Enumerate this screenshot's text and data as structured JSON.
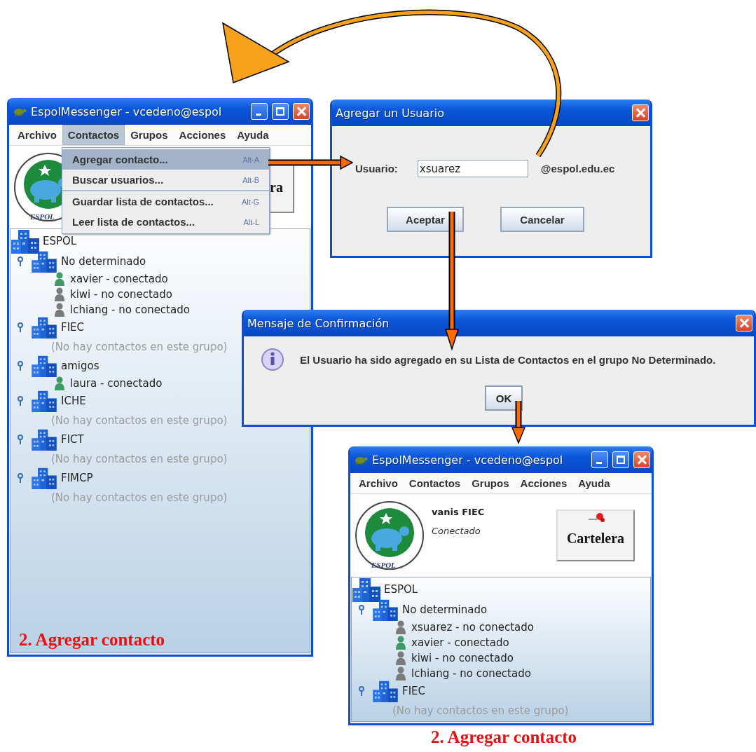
{
  "windows": [
    {
      "kind": "messenger",
      "title": "EspolMessenger - vcedeno@espol",
      "menus": [
        {
          "label": "Archivo",
          "selected": false
        },
        {
          "label": "Contactos",
          "selected": true
        },
        {
          "label": "Grupos",
          "selected": false
        },
        {
          "label": "Acciones",
          "selected": false
        },
        {
          "label": "Ayuda",
          "selected": false
        }
      ],
      "logo_text": "ESPOL",
      "board_button": {
        "label": "ra",
        "pinned": false
      },
      "dropdown": [
        {
          "label": "Agregar contacto...",
          "shortcut": "Alt-A",
          "selected": true,
          "separator_before": false
        },
        {
          "label": "Buscar usuarios...",
          "shortcut": "Alt-B",
          "selected": false,
          "separator_before": false
        },
        {
          "label": "Guardar lista de contactos...",
          "shortcut": "Alt-G",
          "selected": false,
          "separator_before": true
        },
        {
          "label": "Leer lista de contactos...",
          "shortcut": "Alt-L",
          "selected": false,
          "separator_before": false
        }
      ],
      "tree": {
        "label": "ESPOL",
        "kind": "root",
        "children": [
          {
            "label": "No determinado",
            "kind": "group",
            "children": [
              {
                "label": "xavier - conectado",
                "kind": "contact",
                "online": true
              },
              {
                "label": "kiwi - no conectado",
                "kind": "contact",
                "online": false
              },
              {
                "label": "lchiang - no conectado",
                "kind": "contact",
                "online": false
              }
            ]
          },
          {
            "label": "FIEC",
            "kind": "group",
            "children": [
              {
                "label": "(No hay contactos en este grupo)",
                "kind": "note"
              }
            ]
          },
          {
            "label": "amigos",
            "kind": "group",
            "children": [
              {
                "label": "laura - conectado",
                "kind": "contact",
                "online": true
              }
            ]
          },
          {
            "label": "ICHE",
            "kind": "group",
            "children": [
              {
                "label": "(No hay contactos en este grupo)",
                "kind": "note"
              }
            ]
          },
          {
            "label": "FICT",
            "kind": "group",
            "children": [
              {
                "label": "(No hay contactos en este grupo)",
                "kind": "note"
              }
            ]
          },
          {
            "label": "FIMCP",
            "kind": "group",
            "children": [
              {
                "label": "(No hay contactos en este grupo)",
                "kind": "note"
              }
            ]
          }
        ]
      },
      "caption": "2. Agregar contacto"
    },
    {
      "kind": "messenger",
      "title": "EspolMessenger - vcedeno@espol",
      "menus": [
        {
          "label": "Archivo",
          "selected": false
        },
        {
          "label": "Contactos",
          "selected": false
        },
        {
          "label": "Grupos",
          "selected": false
        },
        {
          "label": "Acciones",
          "selected": false
        },
        {
          "label": "Ayuda",
          "selected": false
        }
      ],
      "logo_text": "ESPOL",
      "profile": {
        "name": "vanis FIEC",
        "status": "Conectado"
      },
      "board_button": {
        "label": "Cartelera",
        "pinned": true
      },
      "tree": {
        "label": "ESPOL",
        "kind": "root",
        "children": [
          {
            "label": "No determinado",
            "kind": "group",
            "children": [
              {
                "label": "xsuarez - no conectado",
                "kind": "contact",
                "online": false
              },
              {
                "label": "xavier - conectado",
                "kind": "contact",
                "online": true
              },
              {
                "label": "kiwi - no conectado",
                "kind": "contact",
                "online": false
              },
              {
                "label": "lchiang - no conectado",
                "kind": "contact",
                "online": false
              }
            ]
          },
          {
            "label": "FIEC",
            "kind": "group",
            "children": [
              {
                "label": "(No hay contactos en este grupo)",
                "kind": "note"
              }
            ]
          }
        ]
      }
    }
  ],
  "add_user_dialog": {
    "title": "Agregar un Usuario",
    "field_label": "Usuario:",
    "value": "xsuarez",
    "suffix": "@espol.edu.ec",
    "buttons": [
      "Aceptar",
      "Cancelar"
    ]
  },
  "confirm_dialog": {
    "title": "Mensaje de Confirmación",
    "message": "El Usuario ha sido agregado en su Lista de Contactos en el grupo No Determinado.",
    "button": "OK"
  },
  "figure_caption": "2. Agregar contacto"
}
